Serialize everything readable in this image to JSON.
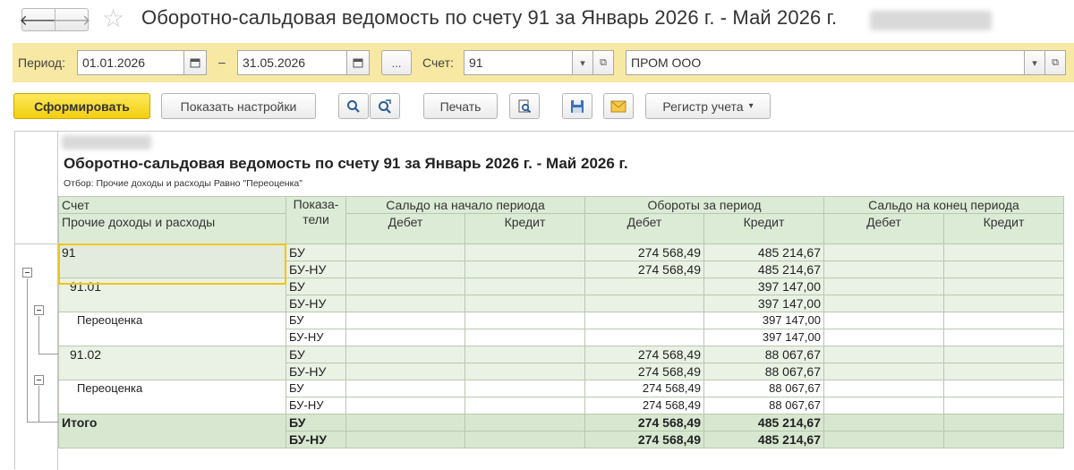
{
  "window": {
    "title": "Оборотно-сальдовая ведомость по счету 91 за Январь 2026 г. - Май 2026 г."
  },
  "period_bar": {
    "period_label": "Период:",
    "date_from": "01.01.2026",
    "dash": "–",
    "date_to": "31.05.2026",
    "more_label": "...",
    "account_label": "Счет:",
    "account_value": "91",
    "org_value": "ПРОМ ООО"
  },
  "toolbar": {
    "generate_label": "Сформировать",
    "show_settings_label": "Показать настройки",
    "print_label": "Печать",
    "register_label": "Регистр учета"
  },
  "report": {
    "title": "Оборотно-сальдовая ведомость по счету 91 за Январь 2026 г. - Май 2026 г.",
    "filter": "Отбор: Прочие доходы и расходы Равно \"Переоценка\"",
    "headers": {
      "account": "Счет",
      "subconto": "Прочие доходы и расходы",
      "indicators_1": "Показа-",
      "indicators_2": "тели",
      "opening": "Сальдо на начало периода",
      "turnover": "Обороты за период",
      "closing": "Сальдо на конец периода",
      "debit": "Дебет",
      "credit": "Кредит"
    },
    "rows": [
      {
        "name": "91",
        "ind": "БУ",
        "td": "274 568,49",
        "tc": "485 214,67"
      },
      {
        "name": "",
        "ind": "БУ-НУ",
        "td": "274 568,49",
        "tc": "485 214,67"
      },
      {
        "name": "91.01",
        "ind": "БУ",
        "td": "",
        "tc": "397 147,00"
      },
      {
        "name": "",
        "ind": "БУ-НУ",
        "td": "",
        "tc": "397 147,00"
      },
      {
        "name": "Переоценка",
        "ind": "БУ",
        "td": "",
        "tc": "397 147,00"
      },
      {
        "name": "",
        "ind": "БУ-НУ",
        "td": "",
        "tc": "397 147,00"
      },
      {
        "name": "91.02",
        "ind": "БУ",
        "td": "274 568,49",
        "tc": "88 067,67"
      },
      {
        "name": "",
        "ind": "БУ-НУ",
        "td": "274 568,49",
        "tc": "88 067,67"
      },
      {
        "name": "Переоценка",
        "ind": "БУ",
        "td": "274 568,49",
        "tc": "88 067,67"
      },
      {
        "name": "",
        "ind": "БУ-НУ",
        "td": "274 568,49",
        "tc": "88 067,67"
      },
      {
        "name": "Итого",
        "ind": "БУ",
        "td": "274 568,49",
        "tc": "485 214,67"
      },
      {
        "name": "",
        "ind": "БУ-НУ",
        "td": "274 568,49",
        "tc": "485 214,67"
      }
    ]
  },
  "colors": {
    "period_bar_bg": "#f7e8a3",
    "primary_button": "#f3cf10",
    "header_bg": "#dcebd6",
    "group_row_bg": "#e9f2e4",
    "total_row_bg": "#d8e7d0",
    "selection_border": "#f2c40e"
  },
  "icons": [
    "back-arrow-icon",
    "forward-arrow-icon",
    "favorite-star-icon",
    "calendar-icon",
    "dropdown-arrow-icon",
    "open-link-icon",
    "search-icon",
    "search-next-icon",
    "print-preview-icon",
    "save-icon",
    "email-icon",
    "tree-collapse-icon"
  ]
}
